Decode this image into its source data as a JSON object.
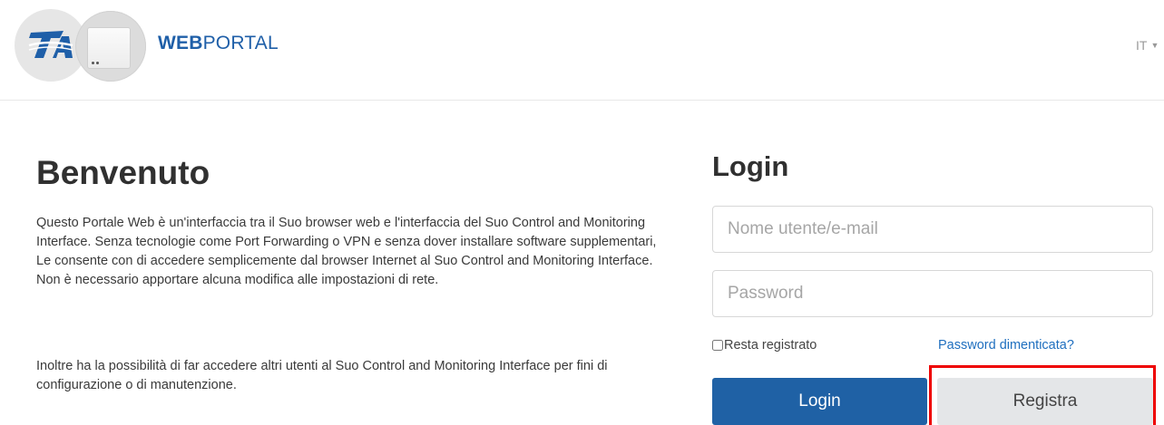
{
  "header": {
    "brand_bold": "WEB",
    "brand_light": "PORTAL",
    "language": "IT",
    "logo_text": "TA"
  },
  "welcome": {
    "title": "Benvenuto",
    "paragraph1": "Questo Portale Web è un'interfaccia tra il Suo browser web e l'interfaccia del Suo Control and Monitoring Interface. Senza tecnologie come Port Forwarding o VPN e senza dover installare software supplementari, Le consente con di accedere semplicemente dal browser Internet al Suo Control and Monitoring Interface. Non è necessario apportare alcuna modifica alle impostazioni di rete.",
    "paragraph2": "Inoltre ha la possibilità di far accedere altri utenti al Suo Control and Monitoring Interface per fini di configurazione o di manutenzione."
  },
  "login": {
    "title": "Login",
    "username_placeholder": "Nome utente/e-mail",
    "username_value": "",
    "password_placeholder": "Password",
    "password_value": "",
    "remember_label": "Resta registrato",
    "remember_checked": false,
    "forgot_label": "Password dimenticata?",
    "login_button": "Login",
    "register_button": "Registra"
  },
  "colors": {
    "brand_blue": "#1f5fa8",
    "login_button_bg": "#1f61a5",
    "register_button_bg": "#e4e6e8",
    "highlight": "#ee0000"
  },
  "icons": {
    "language_caret": "chevron-down-icon"
  }
}
